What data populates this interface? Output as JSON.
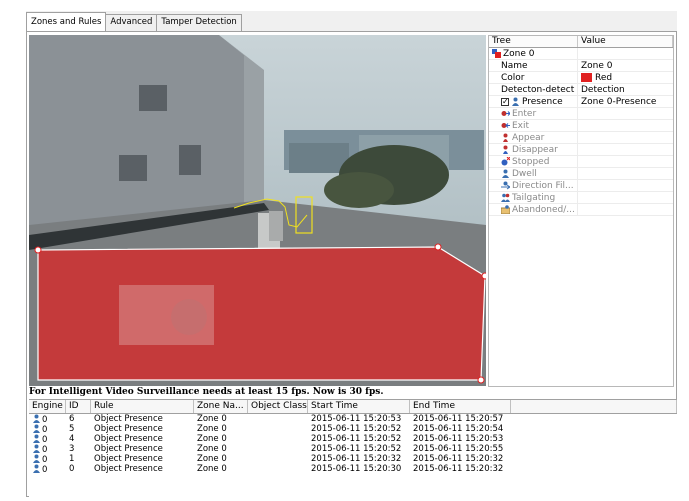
{
  "tabs": [
    "Zones and Rules",
    "Advanced",
    "Tamper Detection"
  ],
  "tree": {
    "headers": {
      "tree": "Tree",
      "value": "Value"
    },
    "rows": [
      {
        "label": "Zone 0",
        "value": "",
        "icon": "zone-icon",
        "indent": 0,
        "enabled": true
      },
      {
        "label": "Name",
        "value": "Zone 0",
        "icon": "",
        "indent": 1,
        "enabled": true
      },
      {
        "label": "Color",
        "value": "Red",
        "icon": "",
        "indent": 1,
        "enabled": true,
        "swatch": "#e02020"
      },
      {
        "label": "Detecton-detect",
        "value": "Detection",
        "icon": "",
        "indent": 1,
        "enabled": true
      },
      {
        "label": "Presence",
        "value": "Zone 0-Presence",
        "icon": "presence-icon",
        "indent": 1,
        "enabled": true,
        "checked": true
      },
      {
        "label": "Enter",
        "value": "",
        "icon": "enter-icon",
        "indent": 1,
        "enabled": false
      },
      {
        "label": "Exit",
        "value": "",
        "icon": "exit-icon",
        "indent": 1,
        "enabled": false
      },
      {
        "label": "Appear",
        "value": "",
        "icon": "appear-icon",
        "indent": 1,
        "enabled": false
      },
      {
        "label": "Disappear",
        "value": "",
        "icon": "disappear-icon",
        "indent": 1,
        "enabled": false
      },
      {
        "label": "Stopped",
        "value": "",
        "icon": "stopped-icon",
        "indent": 1,
        "enabled": false
      },
      {
        "label": "Dwell",
        "value": "",
        "icon": "dwell-icon",
        "indent": 1,
        "enabled": false
      },
      {
        "label": "Direction Fil...",
        "value": "",
        "icon": "direction-filter-icon",
        "indent": 1,
        "enabled": false
      },
      {
        "label": "Tailgating",
        "value": "",
        "icon": "tailgating-icon",
        "indent": 1,
        "enabled": false
      },
      {
        "label": "Abandoned/...",
        "value": "",
        "icon": "abandoned-icon",
        "indent": 1,
        "enabled": false
      }
    ]
  },
  "status_text": "For Intelligent Video Surveillance needs at least 15 fps. Now is 30 fps.",
  "events": {
    "headers": [
      "Engine",
      "ID",
      "Rule",
      "Zone Na...",
      "Object Class",
      "Start Time",
      "End Time"
    ],
    "rows": [
      {
        "engine": "0",
        "id": "6",
        "rule": "Object Presence",
        "zone": "Zone 0",
        "object_class": "",
        "start": "2015-06-11 15:20:53",
        "end": "2015-06-11 15:20:57"
      },
      {
        "engine": "0",
        "id": "5",
        "rule": "Object Presence",
        "zone": "Zone 0",
        "object_class": "",
        "start": "2015-06-11 15:20:52",
        "end": "2015-06-11 15:20:54"
      },
      {
        "engine": "0",
        "id": "4",
        "rule": "Object Presence",
        "zone": "Zone 0",
        "object_class": "",
        "start": "2015-06-11 15:20:52",
        "end": "2015-06-11 15:20:53"
      },
      {
        "engine": "0",
        "id": "3",
        "rule": "Object Presence",
        "zone": "Zone 0",
        "object_class": "",
        "start": "2015-06-11 15:20:52",
        "end": "2015-06-11 15:20:55"
      },
      {
        "engine": "0",
        "id": "1",
        "rule": "Object Presence",
        "zone": "Zone 0",
        "object_class": "",
        "start": "2015-06-11 15:20:32",
        "end": "2015-06-11 15:20:32"
      },
      {
        "engine": "0",
        "id": "0",
        "rule": "Object Presence",
        "zone": "Zone 0",
        "object_class": "",
        "start": "2015-06-11 15:20:30",
        "end": "2015-06-11 15:20:32"
      }
    ]
  },
  "colors": {
    "zone": "#e02020",
    "disabled_text": "#8a8a8a",
    "track": "#f0e020"
  }
}
